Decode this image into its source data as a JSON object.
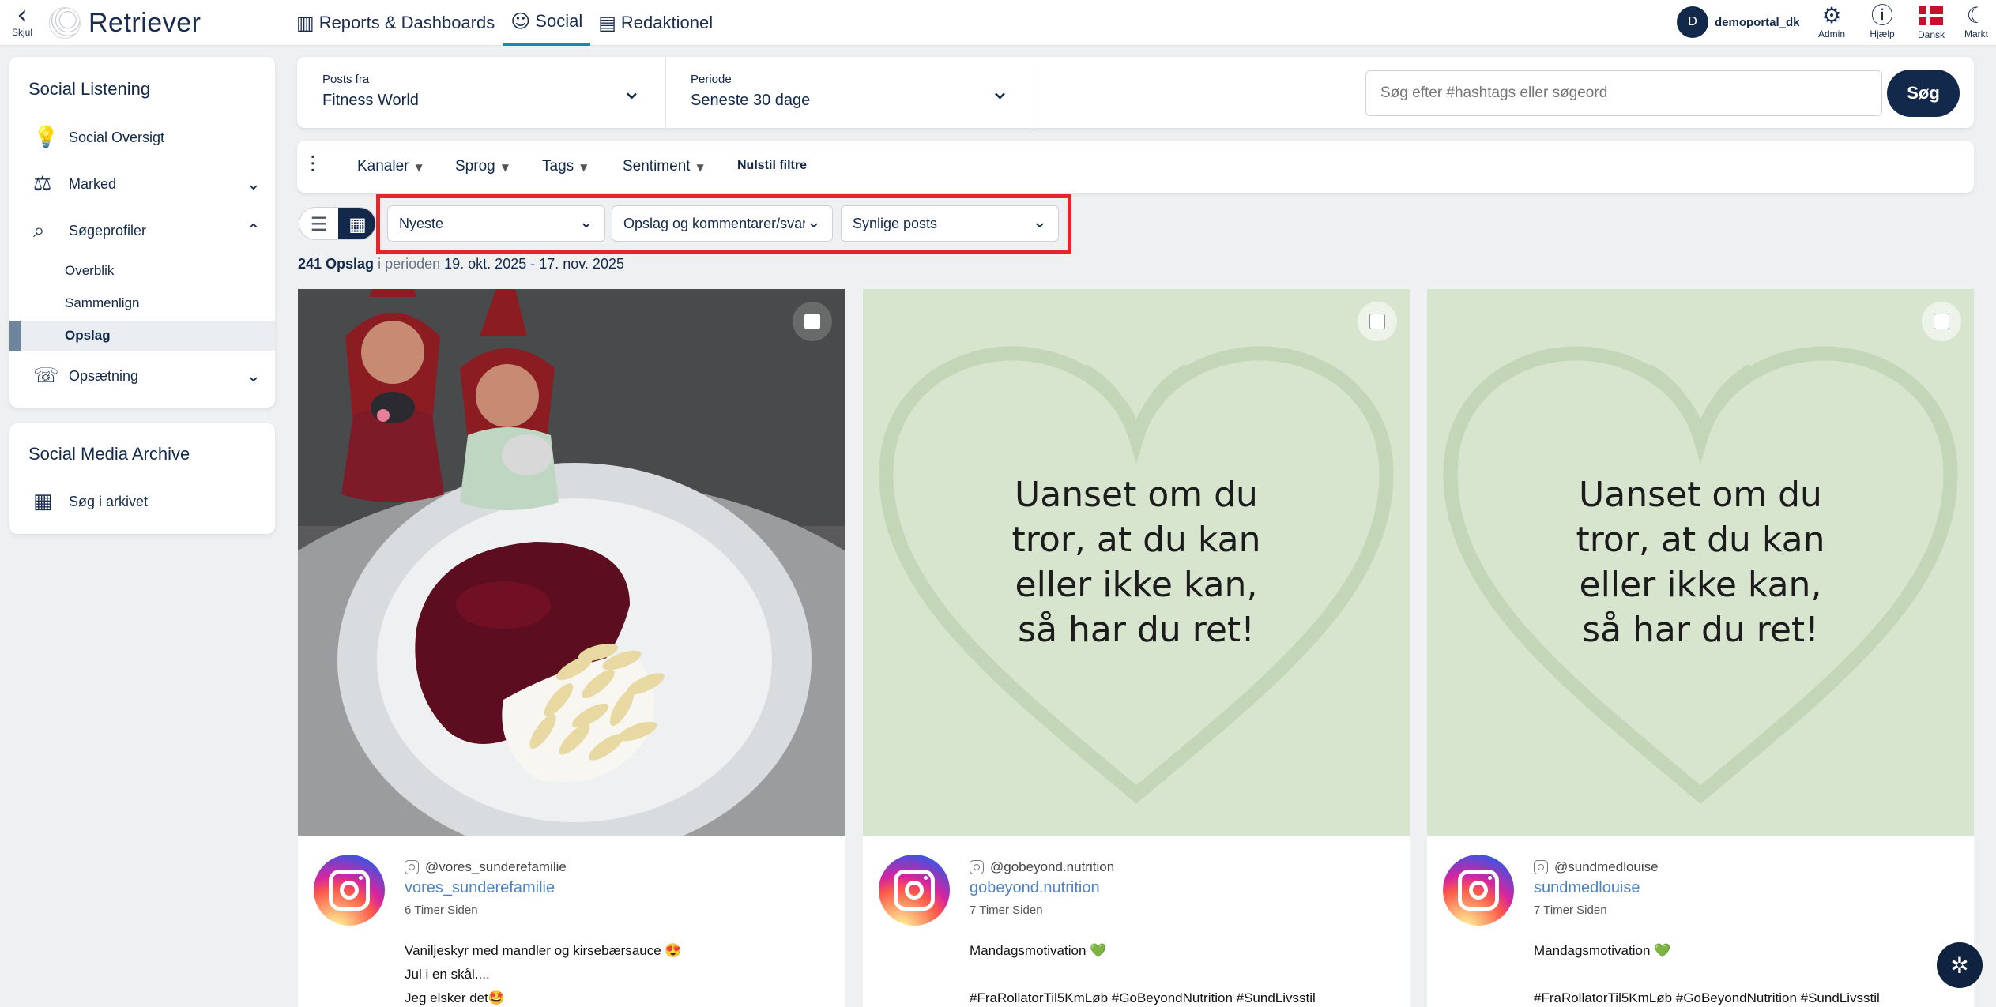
{
  "topbar": {
    "hide_label": "Skjul",
    "logo_text": "Retriever",
    "nav": [
      {
        "label": "Reports & Dashboards",
        "icon": "chart-icon"
      },
      {
        "label": "Social",
        "icon": "chat-icon",
        "active": true
      },
      {
        "label": "Redaktionel",
        "icon": "newspaper-icon"
      }
    ],
    "user_initial": "D",
    "user_name": "demoportal_dk",
    "tools": [
      {
        "label": "Admin",
        "icon": "gear-icon"
      },
      {
        "label": "Hjælp",
        "icon": "info-icon"
      },
      {
        "label": "Dansk",
        "icon": "danish-flag-icon"
      },
      {
        "label": "Markt",
        "icon": "moon-icon"
      }
    ]
  },
  "sidebar": {
    "title": "Social Listening",
    "items": [
      {
        "label": "Social Oversigt",
        "icon": "lightbulb-icon"
      },
      {
        "label": "Marked",
        "icon": "scale-icon"
      },
      {
        "label": "Søgeprofiler",
        "icon": "search-profile-icon"
      },
      {
        "label": "Opsætning",
        "icon": "chat-settings-icon"
      }
    ],
    "subitems": [
      "Overblik",
      "Sammenlign",
      "Opslag"
    ],
    "archive_title": "Social Media Archive",
    "archive_item": "Søg i arkivet"
  },
  "filters": {
    "posts_from_label": "Posts fra",
    "posts_from_value": "Fitness World",
    "period_label": "Periode",
    "period_value": "Seneste 30 dage",
    "search_placeholder": "Søg efter #hashtags eller søgeord",
    "search_button": "Søg",
    "chips": [
      "Kanaler",
      "Sprog",
      "Tags",
      "Sentiment"
    ],
    "reset": "Nulstil filtre"
  },
  "toolbar": {
    "sort": "Nyeste",
    "type": "Opslag og kommentarer/svar",
    "visibility": "Synlige posts"
  },
  "summary": {
    "count": "241 Opslag",
    "period_word": "i perioden",
    "range": "19. okt. 2025 - 17. nov. 2025"
  },
  "posts": [
    {
      "handle": "@vores_sunderefamilie",
      "name": "vores_sunderefamilie",
      "time": "6 Timer Siden",
      "text": "Vaniljeskyr med mandler og kirsebærsauce 😍\nJul i en skål....\nJeg elsker det🤩"
    },
    {
      "handle": "@gobeyond.nutrition",
      "name": "gobeyond.nutrition",
      "time": "7 Timer Siden",
      "text": "Mandagsmotivation 💚\n\n#FraRollatorTil5KmLøb #GoBeyondNutrition #SundLivsstil",
      "image_text": "Uanset om du\ntror, at du kan\neller ikke kan,\nså har du ret!"
    },
    {
      "handle": "@sundmedlouise",
      "name": "sundmedlouise",
      "time": "7 Timer Siden",
      "text": "Mandagsmotivation 💚\n\n#FraRollatorTil5KmLøb #GoBeyondNutrition #SundLivsstil",
      "image_text": "Uanset om du\ntror, at du kan\neller ikke kan,\nså har du ret!"
    }
  ],
  "colors": {
    "brand_navy": "#13294b",
    "active_tab": "#1b87b8",
    "highlight": "#e4252a",
    "quote_bg": "#d7e5cf",
    "link": "#4d83c6"
  }
}
